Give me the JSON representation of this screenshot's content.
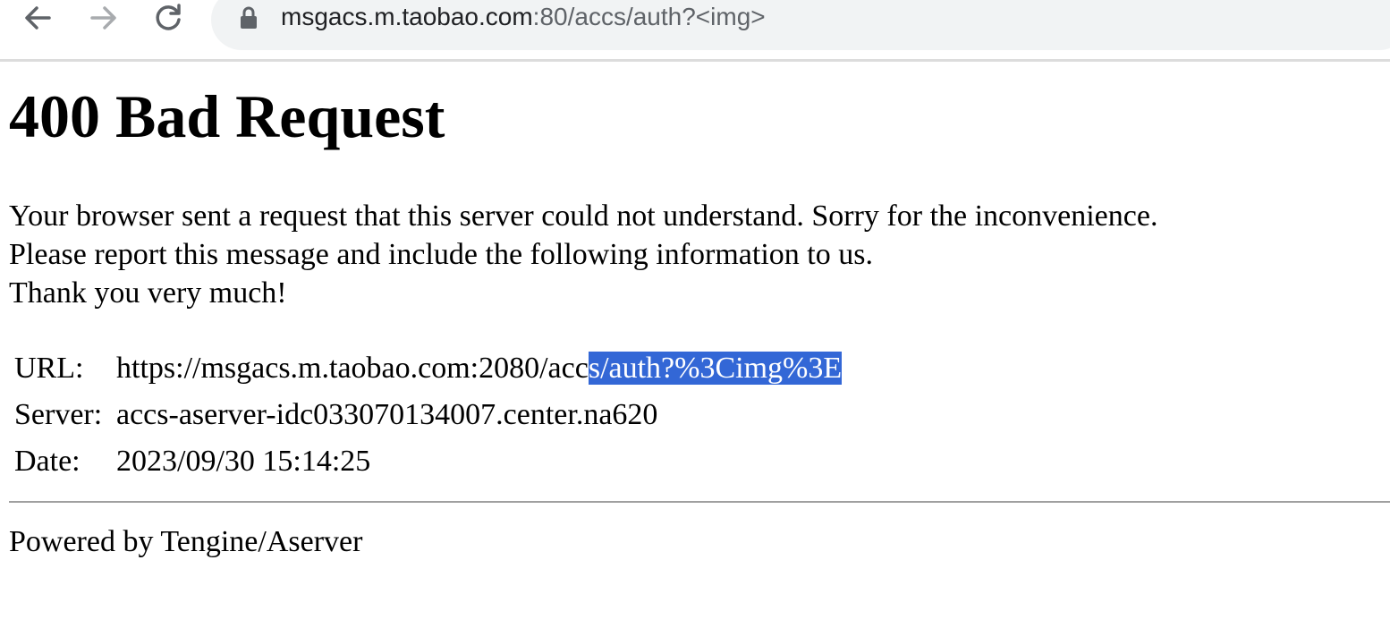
{
  "browser": {
    "address_host": "msgacs.m.taobao.com",
    "address_rest": ":80/accs/auth?<img>",
    "icons": {
      "back": "arrow-left-icon",
      "forward": "arrow-right-icon",
      "reload": "reload-icon",
      "security": "lock-icon"
    }
  },
  "page": {
    "title": "400 Bad Request",
    "message_lines": [
      "Your browser sent a request that this server could not understand. Sorry for the inconvenience.",
      "Please report this message and include the following information to us.",
      "Thank you very much!"
    ],
    "info": {
      "url_label": "URL:",
      "url_value_unselected": "https://msgacs.m.taobao.com:2080/acc",
      "url_value_selected": "s/auth?%3Cimg%3E",
      "server_label": "Server:",
      "server_value": "accs-aserver-idc033070134007.center.na620",
      "date_label": "Date:",
      "date_value": "2023/09/30 15:14:25"
    },
    "footer": "Powered by Tengine/Aserver"
  },
  "colors": {
    "selection": "#3367d6",
    "omnibox": "#f1f3f4"
  }
}
